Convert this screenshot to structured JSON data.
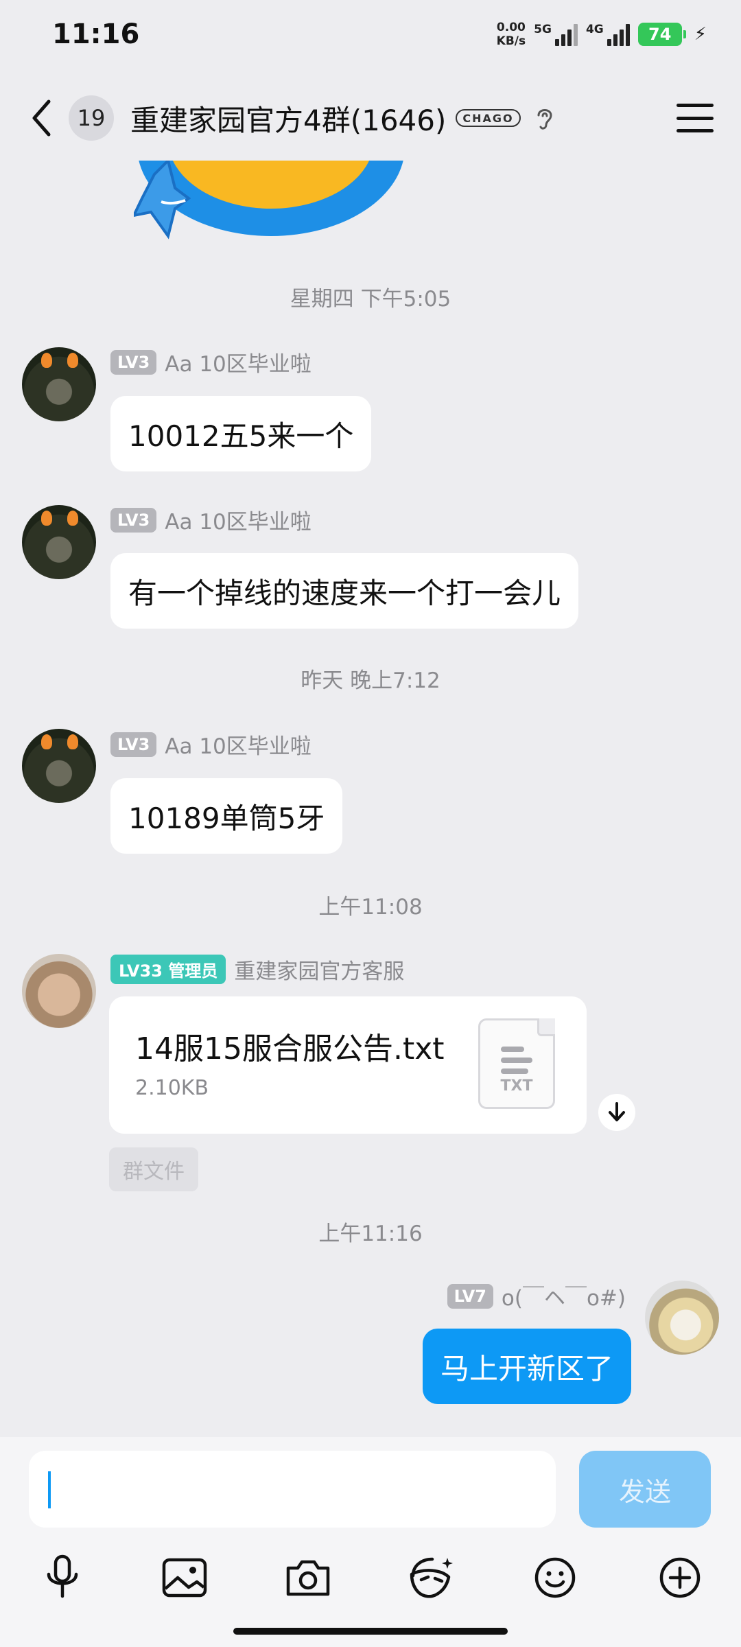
{
  "status_bar": {
    "time": "11:16",
    "net_speed_value": "0.00",
    "net_speed_unit": "KB/s",
    "network_1": "5G",
    "network_2": "4G",
    "battery": "74"
  },
  "header": {
    "unread_count": "19",
    "group_title": "重建家园官方4群(1646)",
    "tag": "CHAGO"
  },
  "messages": [
    {
      "timestamp": "星期四 下午5:05"
    },
    {
      "level": "LV3",
      "sender": "Aa 10区毕业啦",
      "text": "10012五5来一个"
    },
    {
      "level": "LV3",
      "sender": "Aa 10区毕业啦",
      "text": "有一个掉线的速度来一个打一会儿"
    },
    {
      "timestamp": "昨天 晚上7:12"
    },
    {
      "level": "LV3",
      "sender": "Aa 10区毕业啦",
      "text": "10189单筒5牙"
    },
    {
      "timestamp": "上午11:08"
    },
    {
      "level": "LV33 管理员",
      "sender": "重建家园官方客服",
      "file_name": "14服15服合服公告.txt",
      "file_size": "2.10KB",
      "file_type": "TXT",
      "file_tag": "群文件"
    },
    {
      "timestamp": "上午11:16"
    },
    {
      "level": "LV7",
      "sender": "o(￣ヘ￣o#)",
      "text": "马上开新区了"
    }
  ],
  "composer": {
    "input_value": "",
    "send_label": "发送"
  },
  "toolbar": {
    "icons": [
      "microphone-icon",
      "image-icon",
      "camera-icon",
      "sticker-icon",
      "emoji-icon",
      "plus-icon"
    ]
  },
  "colors": {
    "accent": "#0d99f5",
    "admin_badge": "#3cc7b7",
    "battery": "#34c759",
    "background": "#ededf0"
  }
}
